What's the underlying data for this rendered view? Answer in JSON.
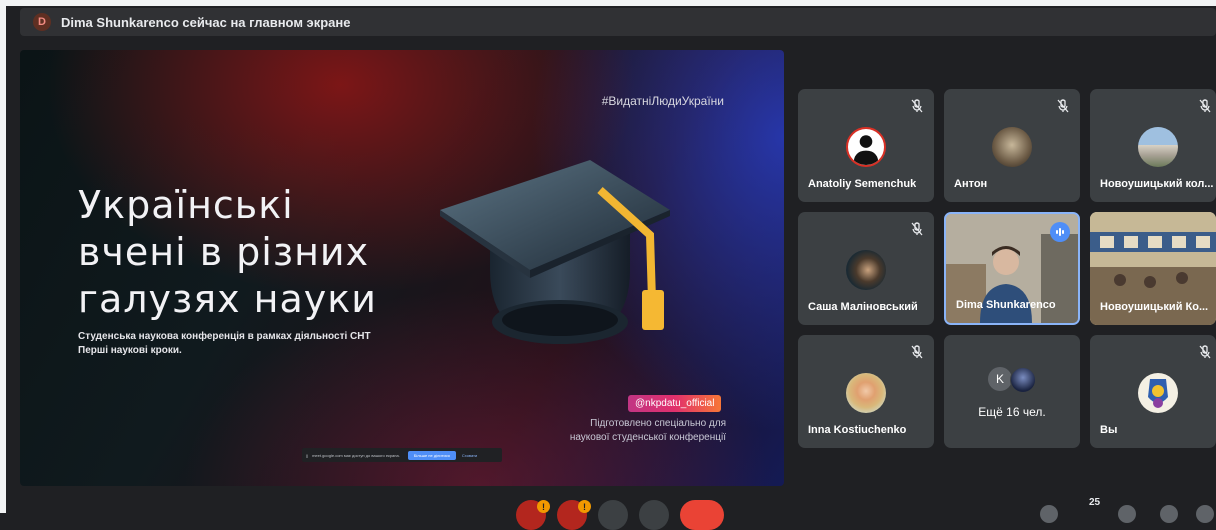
{
  "presenter_banner": {
    "avatar_letter": "D",
    "text": "Dima Shunkarenco сейчас на главном экране"
  },
  "slide": {
    "hashtag": "#ВидатніЛюдиУкраїни",
    "title_line1": "Українські",
    "title_line2": "вчені в різних",
    "title_line3": "галузях науки",
    "subtitle_line1": "Студенська наукова конференція в рамках діяльності СНТ",
    "subtitle_line2": "Перші наукові кроки.",
    "instagram": "@nkpdatu_official",
    "prepared_line1": "Підготовлено спеціально для",
    "prepared_line2": "наукової студенської конференції"
  },
  "share_bar": {
    "text": "meet.google.com має доступ до вашого екрана.",
    "stop_label": "Більше не ділитися",
    "hide_label": "Сховати"
  },
  "participants": [
    {
      "name": "Anatoliy Semenchuk",
      "muted": true
    },
    {
      "name": "Антон",
      "muted": true
    },
    {
      "name": "Новоушицький кол...",
      "muted": true
    },
    {
      "name": "Саша Маліновський",
      "muted": true
    },
    {
      "name": "Dima Shunkarenco",
      "muted": false,
      "speaking": true
    },
    {
      "name": "Новоушицький Ко...",
      "muted": false
    },
    {
      "name": "Inna Kostiuchenko",
      "muted": true
    },
    {
      "name": "Вы",
      "muted": true
    }
  ],
  "more_tile": {
    "avatar_letter": "K",
    "text": "Ещё 16 чел."
  },
  "bottom_bar": {
    "participants_count": "25",
    "badge_mark": "!"
  }
}
